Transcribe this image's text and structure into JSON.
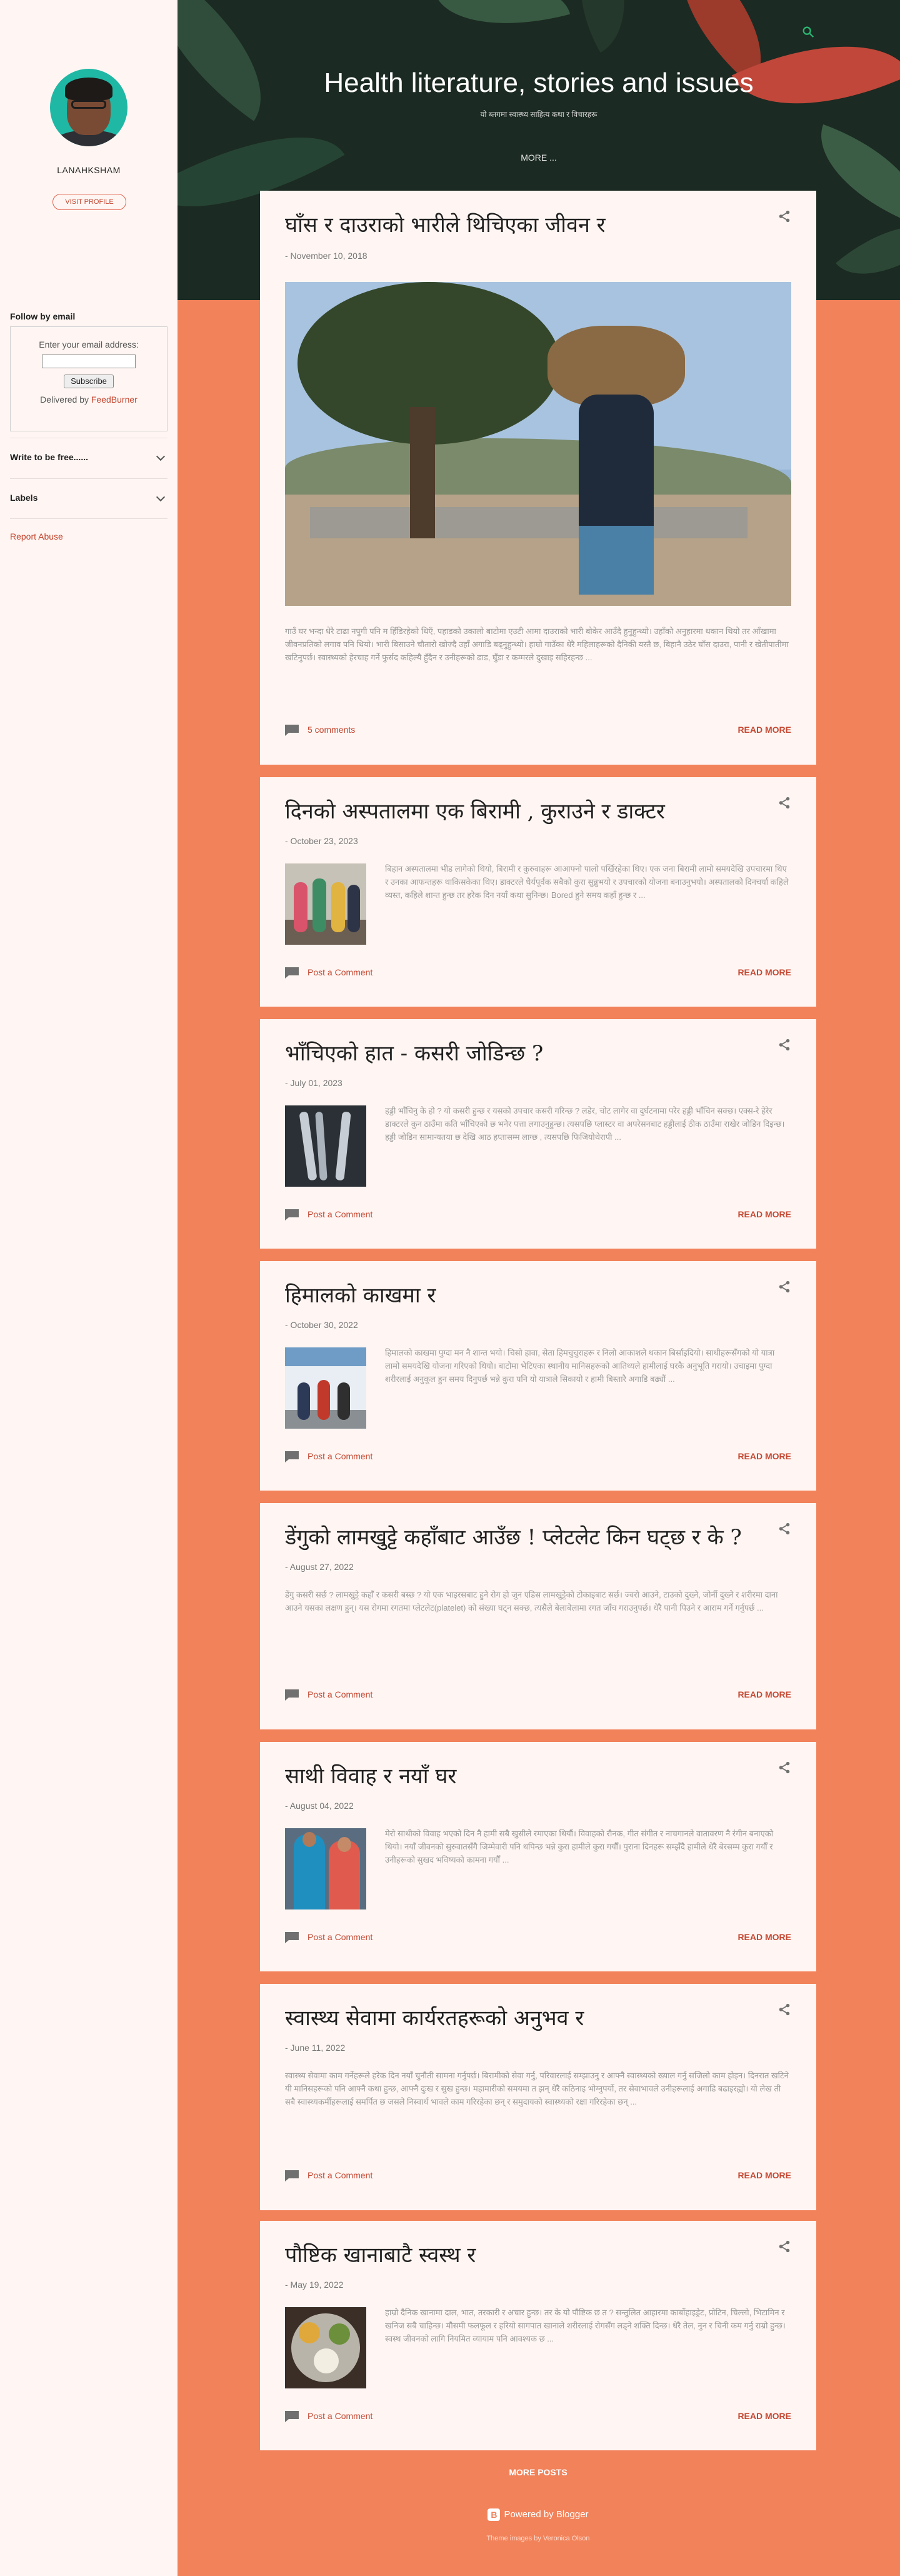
{
  "blog": {
    "title": "Health literature, stories and issues",
    "description": "यो ब्लगमा स्वास्थ्य साहित्य कथा र विचारहरू",
    "more_label": "MORE ..."
  },
  "profile": {
    "name": "LANAHKSHAM",
    "visit_label": "VISIT PROFILE"
  },
  "follow": {
    "title": "Follow by email",
    "email_label": "Enter your email address:",
    "email_value": "",
    "subscribe_label": "Subscribe",
    "delivered_prefix": "Delivered by ",
    "delivered_link": "FeedBurner"
  },
  "sidebar_sections": [
    {
      "label": "Write to be free......"
    },
    {
      "label": "Labels"
    }
  ],
  "report_abuse": "Report Abuse",
  "posts": [
    {
      "title": "घाँस र दाउराको भारीले थिचिएका जीवन र",
      "date": "- November 10, 2018",
      "snippet": "गाउँ घर भन्दा धेरै टाढा नपुगी पनि म हिँडिरहेको थिएँ, पहाडको उकालो बाटोमा एउटी आमा दाउराको भारी बोकेर आउँदै हुनुहुन्थ्यो। उहाँको अनुहारमा थकान थियो तर आँखामा जीवनप्रतिको लगाव पनि थियो। भारी बिसाउने चौतारो खोज्दै उहाँ अगाडि बढ्नुहुन्थ्यो। हाम्रो गाउँका धेरै महिलाहरूको दैनिकी यस्तै छ, बिहानै उठेर घाँस दाउरा, पानी र खेतीपातीमा खटिनुपर्छ। स्वास्थ्यको हेरचाह गर्ने फुर्सद कहिल्यै हुँदैन र उनीहरूको ढाड, घुँडा र कम्मरले दुखाइ सहिरहन्छ ...",
      "comments": "5 comments",
      "read_more": "READ MORE"
    },
    {
      "title": "दिनको अस्पतालमा एक बिरामी , कुराउने र डाक्टर",
      "date": "- October 23, 2023",
      "snippet": "बिहान अस्पतालमा भीड लागेको थियो, बिरामी र कुरुवाहरू आआफ्नो पालो पर्खिरहेका थिए। एक जना बिरामी लामो समयदेखि उपचारमा थिए र उनका आफन्तहरू थाकिसकेका थिए। डाक्टरले धैर्यपूर्वक सबैको कुरा सुन्नुभयो र उपचारको योजना बनाउनुभयो। अस्पतालको दिनचर्या कहिले व्यस्त, कहिले शान्त हुन्छ तर हरेक दिन नयाँ कथा सुनिन्छ। Bored हुने समय कहाँ हुन्छ र ...",
      "comments": "Post a Comment",
      "read_more": "READ MORE"
    },
    {
      "title": "भाँचिएको हात - कसरी जोडिन्छ ?",
      "date": "- July 01, 2023",
      "snippet": "हड्डी भाँचिनु के हो ? यो कसरी हुन्छ र यसको उपचार कसरी गरिन्छ ? लडेर, चोट लागेर वा दुर्घटनामा परेर हड्डी भाँचिन सक्छ। एक्स-रे हेरेर डाक्टरले कुन ठाउँमा कति भाँचिएको छ भनेर पत्ता लगाउनुहुन्छ। त्यसपछि प्लास्टर वा अपरेसनबाट हड्डीलाई ठीक ठाउँमा राखेर जोडिन दिइन्छ। हड्डी जोडिन सामान्यतया छ देखि आठ हप्तासम्म लाग्छ , त्यसपछि फिजियोथेरापी ...",
      "comments": "Post a Comment",
      "read_more": "READ MORE"
    },
    {
      "title": "हिमालको काखमा र",
      "date": "- October 30, 2022",
      "snippet": "हिमालको काखमा पुग्दा मन नै शान्त भयो। चिसो हावा, सेता हिमचुचुराहरू र निलो आकाशले थकान बिर्साइदियो। साथीहरूसँगको यो यात्रा लामो समयदेखि योजना गरिएको थियो। बाटोमा भेटिएका स्थानीय मानिसहरूको आतिथ्यले हामीलाई घरकै अनुभूति गरायो। उचाइमा पुग्दा शरीरलाई अनुकूल हुन समय दिनुपर्छ भन्ने कुरा पनि यो यात्राले सिकायो र हामी बिस्तारै अगाडि बढ्यौं ...",
      "comments": "Post a Comment",
      "read_more": "READ MORE"
    },
    {
      "title": "डेंगुको लामखुट्टे कहाँबाट आउँछ ! प्लेटलेट किन घट्छ र के ?",
      "date": "- August 27, 2022",
      "snippet": "डेंगु कसरी सर्छ ? लामखुट्टे कहाँ र कसरी बस्छ ? यो एक भाइरसबाट हुने रोग हो जुन एडिस लामखुट्टेको टोकाइबाट सर्छ। ज्वरो आउने, टाउको दुख्ने, जोर्नी दुख्ने र शरीरमा दाना आउने यसका लक्षण हुन्। यस रोगमा रगतमा प्लेटलेट(platelet) को संख्या घट्न सक्छ, त्यसैले बेलाबेलामा रगत जाँच गराउनुपर्छ। धेरै पानी पिउने र आराम गर्ने गर्नुपर्छ ...",
      "comments": "Post a Comment",
      "read_more": "READ MORE"
    },
    {
      "title": "साथी विवाह र नयाँ घर",
      "date": "- August 04, 2022",
      "snippet": "मेरो साथीको विवाह भएको दिन नै हामी सबै खुसीले रमाएका थियौं। विवाहको रौनक, गीत संगीत र नाचगानले वातावरण नै रंगीन बनाएको थियो। नयाँ जीवनको सुरुवातसँगै जिम्मेवारी पनि थपिन्छ भन्ने कुरा हामीले कुरा गर्यौं। पुराना दिनहरू सम्झँदै हामीले धेरै बेरसम्म कुरा गर्यौं र उनीहरूको सुखद भविष्यको कामना गर्यौं ...",
      "comments": "Post a Comment",
      "read_more": "READ MORE"
    },
    {
      "title": "स्वास्थ्य सेवामा कार्यरतहरूको अनुभव र",
      "date": "- June 11, 2022",
      "snippet": "स्वास्थ्य सेवामा काम गर्नेहरूले हरेक दिन नयाँ चुनौती सामना गर्नुपर्छ। बिरामीको सेवा गर्नु, परिवारलाई सम्झाउनु र आफ्नै स्वास्थ्यको ख्याल गर्नु सजिलो काम होइन। दिनरात खटिने यी मानिसहरूको पनि आफ्नै कथा हुन्छ, आफ्नै दुःख र सुख हुन्छ। महामारीको समयमा त झन् धेरै कठिनाइ भोग्नुपर्यो, तर सेवाभावले उनीहरूलाई अगाडि बढाइरह्यो। यो लेख ती सबै स्वास्थ्यकर्मीहरूलाई समर्पित छ जसले निस्वार्थ भावले काम गरिरहेका छन् र समुदायको स्वास्थ्यको रक्षा गरिरहेका छन् ...",
      "comments": "Post a Comment",
      "read_more": "READ MORE"
    },
    {
      "title": "पौष्टिक खानाबाटै स्वस्थ र",
      "date": "- May 19, 2022",
      "snippet": "हाम्रो दैनिक खानामा दाल, भात, तरकारी र अचार हुन्छ। तर के यो पौष्टिक छ त ? सन्तुलित आहारमा कार्बोहाइड्रेट, प्रोटिन, चिल्लो, भिटामिन र खनिज सबै चाहिन्छ। मौसमी फलफूल र हरियो सागपात खानाले शरीरलाई रोगसँग लड्ने शक्ति दिन्छ। धेरै तेल, नुन र चिनी कम गर्नु राम्रो हुन्छ। स्वस्थ जीवनको लागि नियमित व्यायाम पनि आवश्यक छ ...",
      "comments": "Post a Comment",
      "read_more": "READ MORE"
    }
  ],
  "footer": {
    "more_posts": "MORE POSTS",
    "powered_by": "Powered by Blogger",
    "theme_credit": "Theme images by Veronica Olson"
  },
  "colors": {
    "accent": "#c44731",
    "page_background": "#f2825a",
    "card_background": "#fff6f3"
  }
}
